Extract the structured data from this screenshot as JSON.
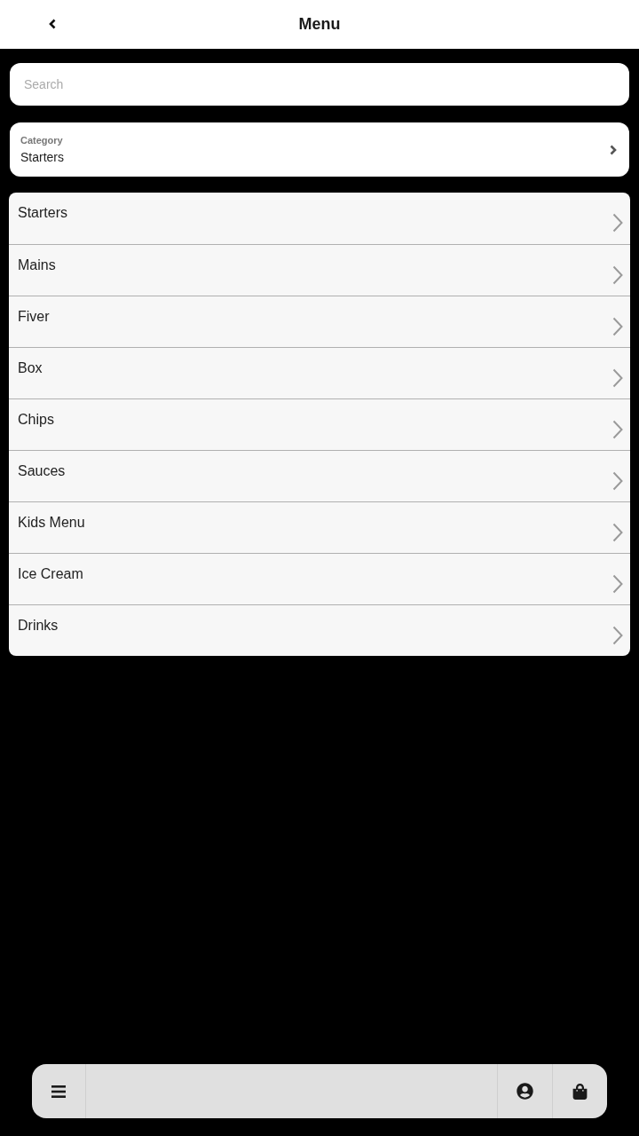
{
  "header": {
    "title": "Menu"
  },
  "search": {
    "placeholder": "Search"
  },
  "category": {
    "label": "Category",
    "value": "Starters"
  },
  "items": [
    {
      "label": "Starters"
    },
    {
      "label": "Mains"
    },
    {
      "label": "Fiver"
    },
    {
      "label": "Box"
    },
    {
      "label": "Chips"
    },
    {
      "label": "Sauces"
    },
    {
      "label": "Kids Menu"
    },
    {
      "label": "Ice Cream"
    },
    {
      "label": "Drinks"
    }
  ]
}
